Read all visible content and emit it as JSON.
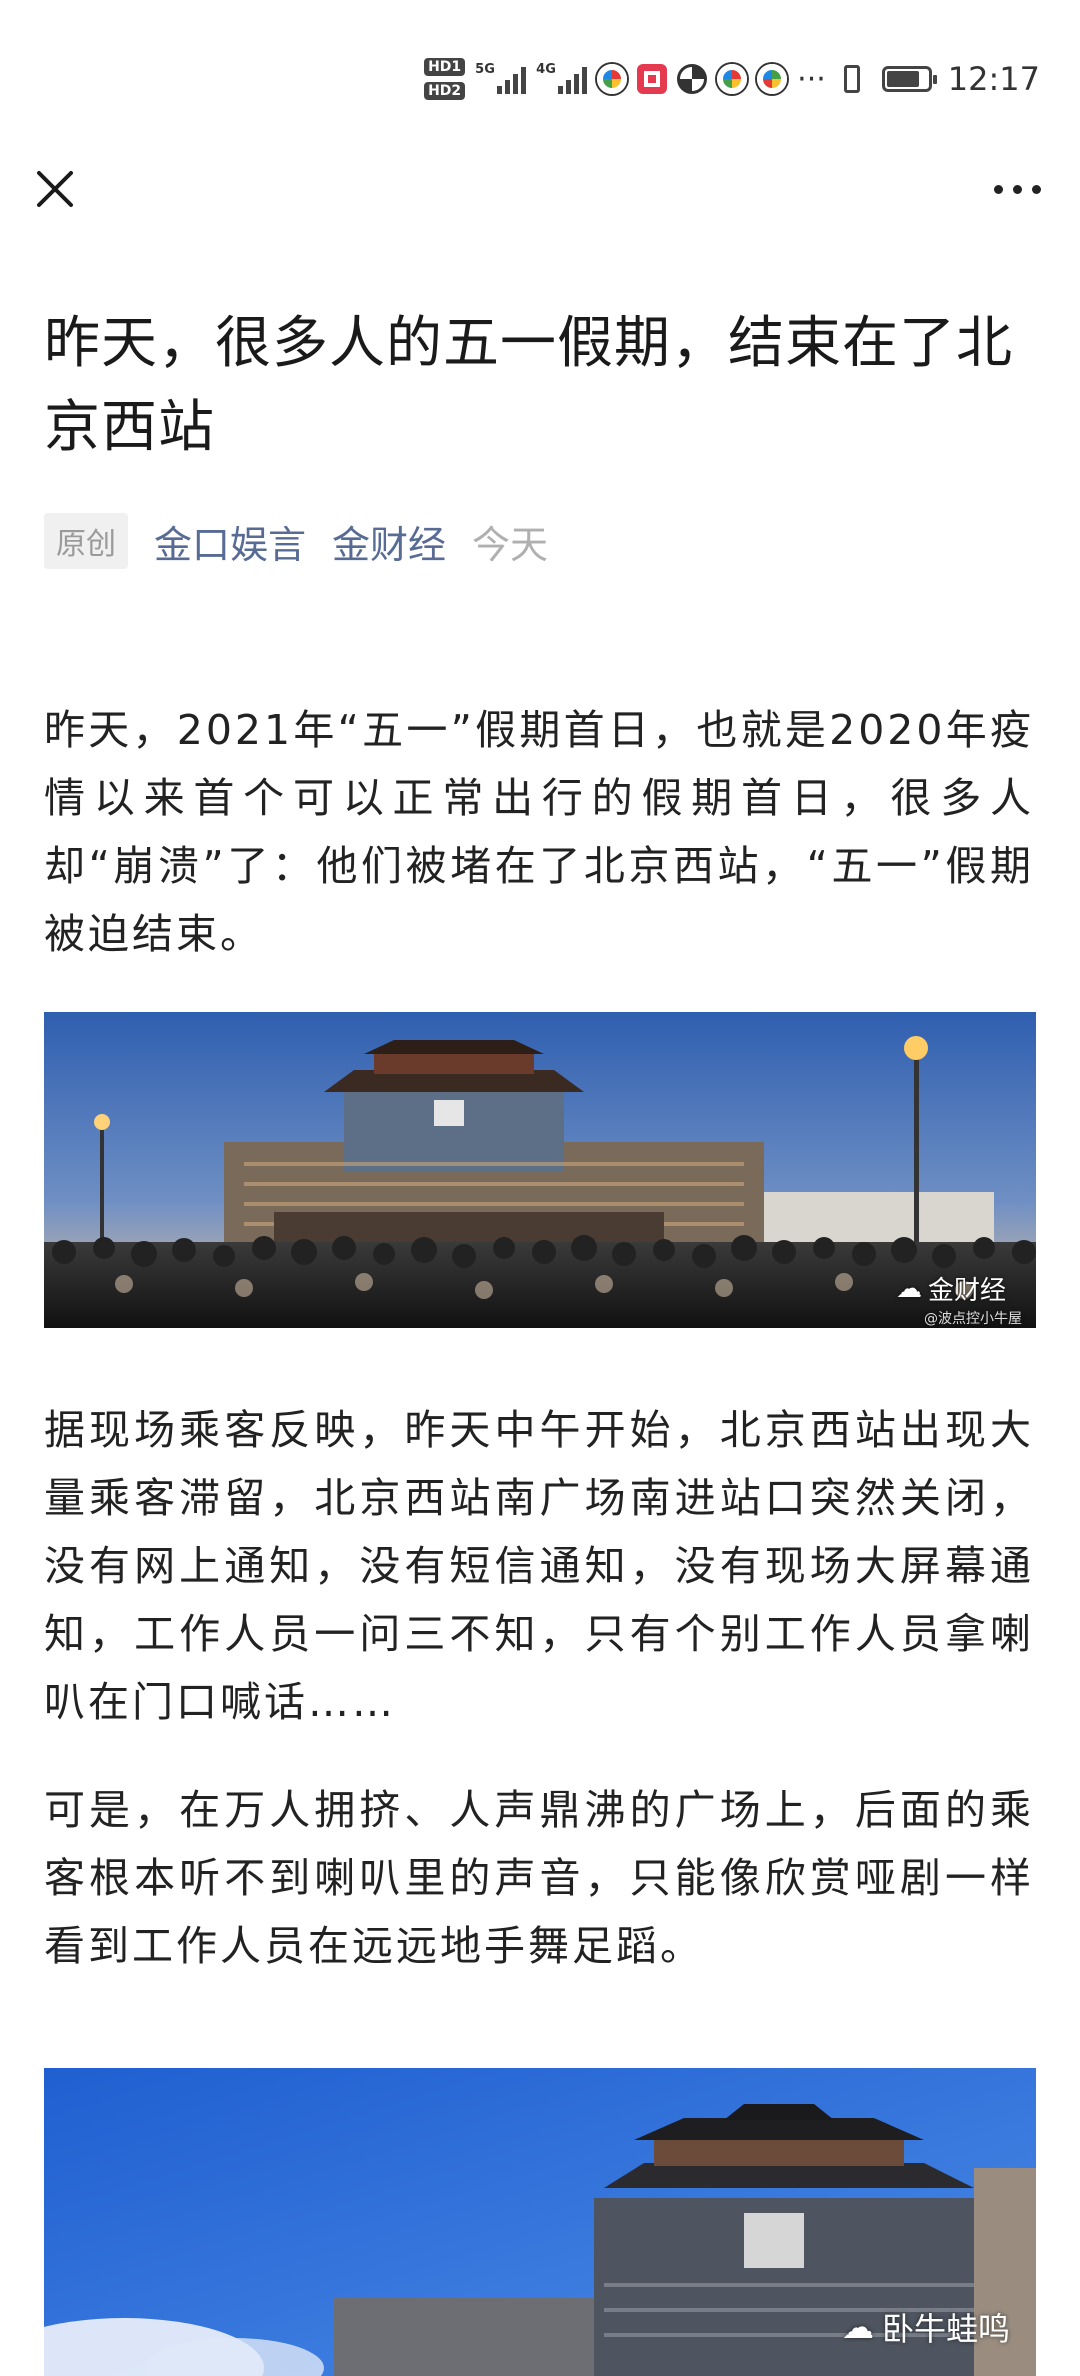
{
  "status_bar": {
    "hd1": "HD1",
    "hd2": "HD2",
    "net1": "5G",
    "net2": "4G",
    "overflow": "···",
    "time": "12:17",
    "battery_level": 0.8
  },
  "nav": {
    "close_icon": "close-icon",
    "more_icon": "more-icon"
  },
  "article": {
    "title": "昨天，很多人的五一假期，结束在了北京西站",
    "badge": "原创",
    "author": "金口娱言",
    "account": "金财经",
    "date": "今天",
    "paragraphs": [
      "昨天，2021年“五一”假期首日，也就是2020年疫情以来首个可以正常出行的假期首日，很多人却“崩溃”了：他们被堵在了北京西站，“五一”假期被迫结束。",
      "据现场乘客反映，昨天中午开始，北京西站出现大量乘客滞留，北京西站南广场南进站口突然关闭，没有网上通知，没有短信通知，没有现场大屏幕通知，工作人员一问三不知，只有个别工作人员拿喇叭在门口喊话……",
      "可是，在万人拥挤、人声鼎沸的广场上，后面的乘客根本听不到喇叭里的声音，只能像欣赏哑剧一样看到工作人员在远远地手舞足蹈。"
    ],
    "photo1_watermark": "金财经",
    "photo1_credit": "@波点控小牛屋",
    "photo2_watermark": "卧牛蛙鸣"
  }
}
